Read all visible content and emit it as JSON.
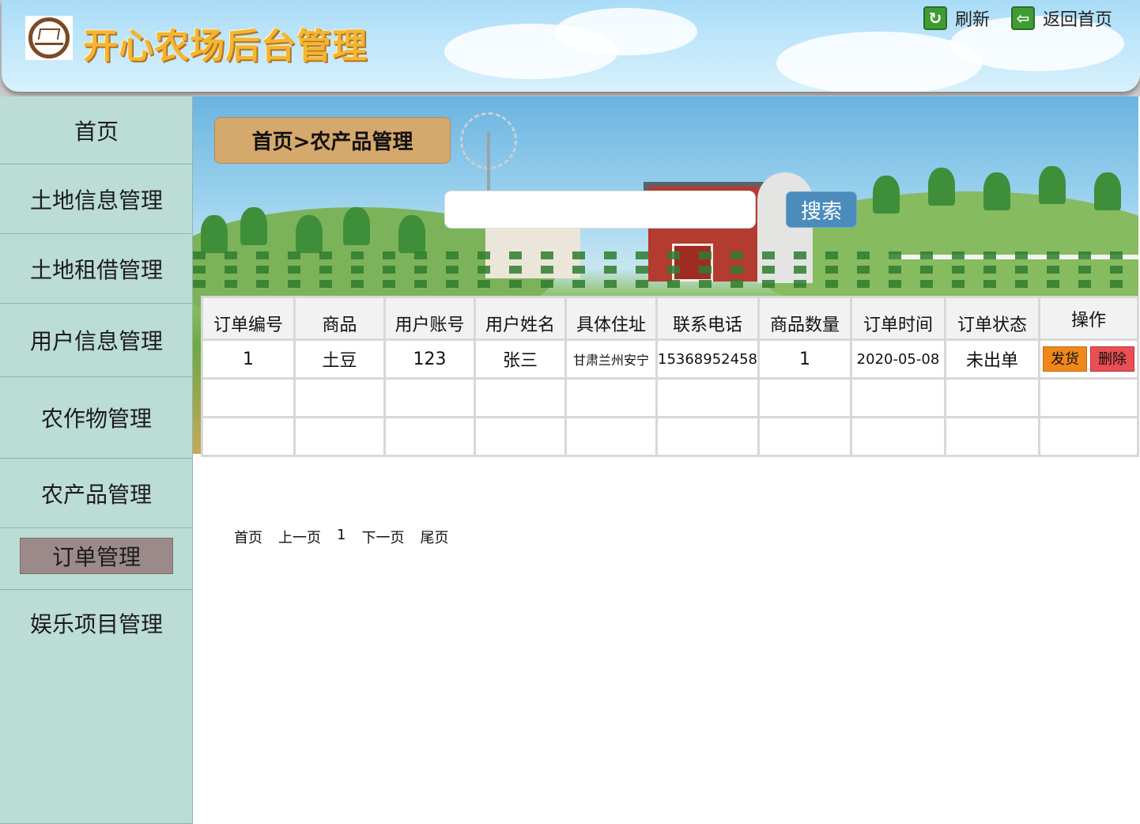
{
  "header": {
    "site_title": "开心农场后台管理",
    "refresh_label": "刷新",
    "back_home_label": "返回首页"
  },
  "sidebar": {
    "items": [
      {
        "label": "首页"
      },
      {
        "label": "土地信息管理"
      },
      {
        "label": "土地租借管理"
      },
      {
        "label": "用户信息管理"
      },
      {
        "label": "农作物管理"
      },
      {
        "label": "农产品管理"
      },
      {
        "label": "订单管理",
        "active": true
      },
      {
        "label": "娱乐项目管理"
      }
    ]
  },
  "main": {
    "breadcrumb": "首页>农产品管理",
    "search": {
      "value": "",
      "placeholder": ""
    },
    "search_button": "搜索",
    "table": {
      "headers": [
        "订单编号",
        "商品",
        "用户账号",
        "用户姓名",
        "具体住址",
        "联系电话",
        "商品数量",
        "订单时间",
        "订单状态",
        "操作"
      ],
      "rows": [
        {
          "order_id": "1",
          "product": "土豆",
          "account": "123",
          "name": "张三",
          "address": "甘肃兰州安宁",
          "phone": "15368952458",
          "quantity": "1",
          "time": "2020-05-08",
          "status": "未出单",
          "ship_label": "发货",
          "delete_label": "删除"
        }
      ]
    },
    "pager": {
      "first": "首页",
      "prev": "上一页",
      "current": "1",
      "next": "下一页",
      "last": "尾页"
    }
  },
  "colors": {
    "sidebar_bg": "#bcdcd6",
    "active_nav_bg": "#9c8a8a",
    "breadcrumb_bg": "#d5a86c",
    "search_button_bg": "#4b8cbc",
    "ship_button_bg": "#f0871b",
    "delete_button_bg": "#e94f55",
    "title_color": "#f4b631"
  },
  "icons": {
    "refresh": "refresh-icon",
    "back": "back-arrow-icon"
  }
}
